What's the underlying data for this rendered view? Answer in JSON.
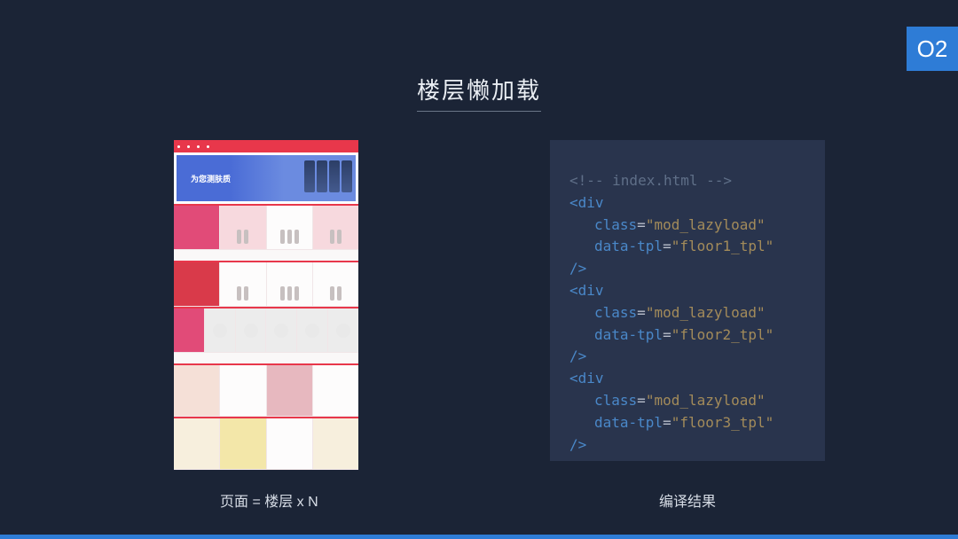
{
  "badge": "O2",
  "title": "楼层懒加载",
  "left_caption": "页面 = 楼层 x N",
  "right_caption": "编译结果",
  "banner_text": "为您测肤质",
  "code": {
    "comment_open": "<!--",
    "comment_file": " index.html ",
    "comment_close": "-->",
    "tag_div_open": "<div",
    "attr_class": "class",
    "attr_data_tpl": "data-tpl",
    "eq": "=",
    "q": "\"",
    "val_class": "mod_lazyload",
    "val_tpl1": "floor1_tpl",
    "val_tpl2": "floor2_tpl",
    "val_tpl3": "floor3_tpl",
    "self_close": "/>"
  }
}
